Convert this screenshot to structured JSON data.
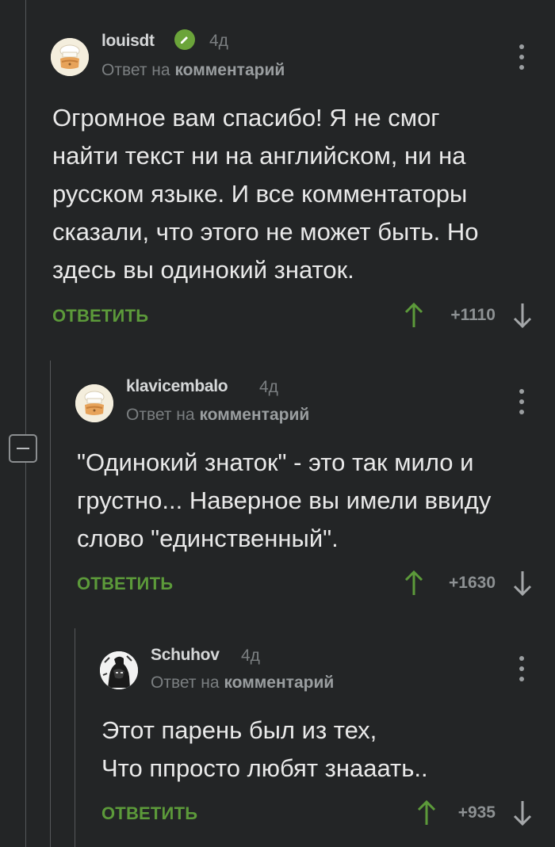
{
  "comments": [
    {
      "author": "louisdt",
      "time": "4д",
      "reply_prefix": "Ответ на",
      "reply_target": "комментарий",
      "text_lines": [
        "Огромное вам спасибо! Я не смог",
        "найти текст ни на английском, ни на",
        "русском языке. И все комментаторы",
        "сказали, что этого не может быть. Но",
        "здесь вы одинокий знаток."
      ],
      "reply_label": "ОТВЕТИТЬ",
      "score": "+1110",
      "verified": true
    },
    {
      "author": "klavicembalo",
      "time": "4д",
      "reply_prefix": "Ответ на",
      "reply_target": "комментарий",
      "text_lines": [
        "\"Одинокий знаток\" - это так мило и",
        "грустно... Наверное вы имели ввиду",
        "слово \"единственный\"."
      ],
      "reply_label": "ОТВЕТИТЬ",
      "score": "+1630",
      "verified": false
    },
    {
      "author": "Schuhov",
      "time": "4д",
      "reply_prefix": "Ответ на",
      "reply_target": "комментарий",
      "text_lines": [
        "Этот парень был из тех,",
        "Что ппросто любят знааать.."
      ],
      "reply_label": "ОТВЕТИТЬ",
      "score": "+935",
      "verified": false
    }
  ],
  "colors": {
    "background": "#232526",
    "accent_green": "#5c9a3a",
    "muted": "#7b7f81"
  },
  "icons": [
    "collapse-icon",
    "verified-icon",
    "menu-dots-icon",
    "arrow-up-icon",
    "arrow-down-icon",
    "chef-hat-avatar",
    "dark-portrait-avatar"
  ]
}
